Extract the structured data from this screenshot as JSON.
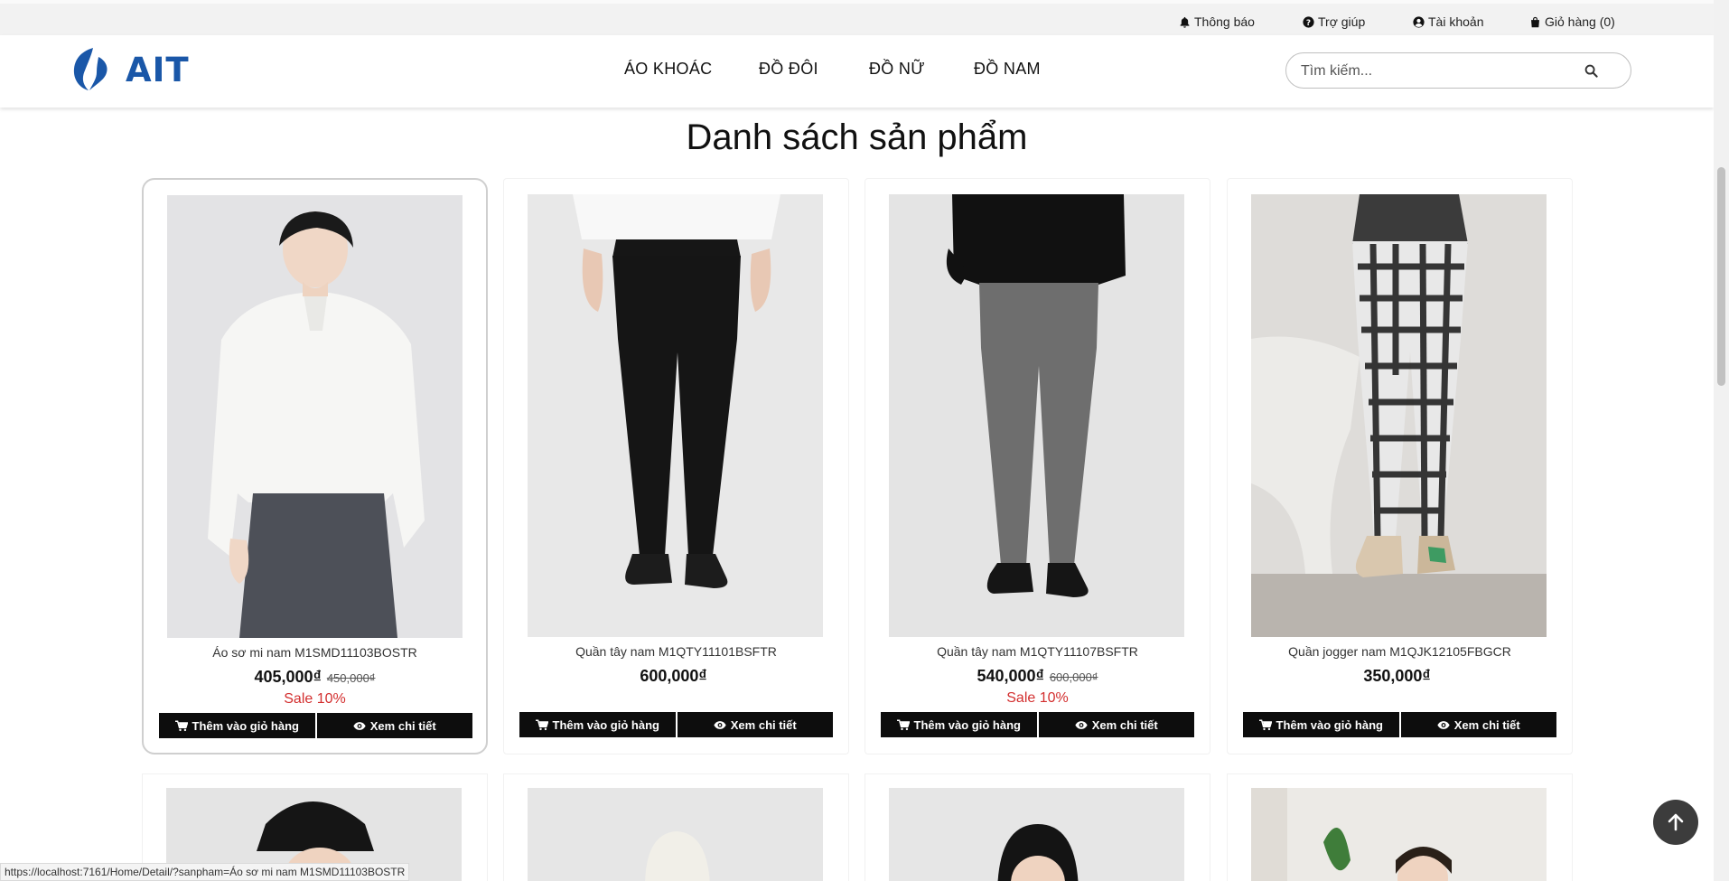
{
  "topbar": {
    "notifications": "Thông báo",
    "help": "Trợ giúp",
    "account": "Tài khoản",
    "cart": "Giỏ hàng (0)"
  },
  "header": {
    "logo_text": "AIT",
    "brand_color": "#1a57a8",
    "nav": [
      "ÁO KHOÁC",
      "ĐỒ ĐÔI",
      "ĐỒ NỮ",
      "ĐỒ NAM"
    ],
    "search_placeholder": "Tìm kiếm..."
  },
  "page_title": "Danh sách sản phẩm",
  "buttons": {
    "add_to_cart": "Thêm vào giỏ hàng",
    "view_detail": "Xem chi tiết"
  },
  "products": [
    {
      "name": "Áo sơ mi nam M1SMD11103BOSTR",
      "price": "405,000₫",
      "old_price": "450,000₫",
      "sale": "Sale 10%"
    },
    {
      "name": "Quần tây nam M1QTY11101BSFTR",
      "price": "600,000₫",
      "old_price": "",
      "sale": ""
    },
    {
      "name": "Quần tây nam M1QTY11107BSFTR",
      "price": "540,000₫",
      "old_price": "600,000₫",
      "sale": "Sale 10%"
    },
    {
      "name": "Quần jogger nam M1QJK12105FBGCR",
      "price": "350,000₫",
      "old_price": "",
      "sale": ""
    }
  ],
  "status_url": "https://localhost:7161/Home/Detail/?sanpham=Áo sơ mi nam M1SMD11103BOSTR",
  "colors": {
    "sale": "#d32f2f",
    "button_bg": "#0d0d0d"
  }
}
